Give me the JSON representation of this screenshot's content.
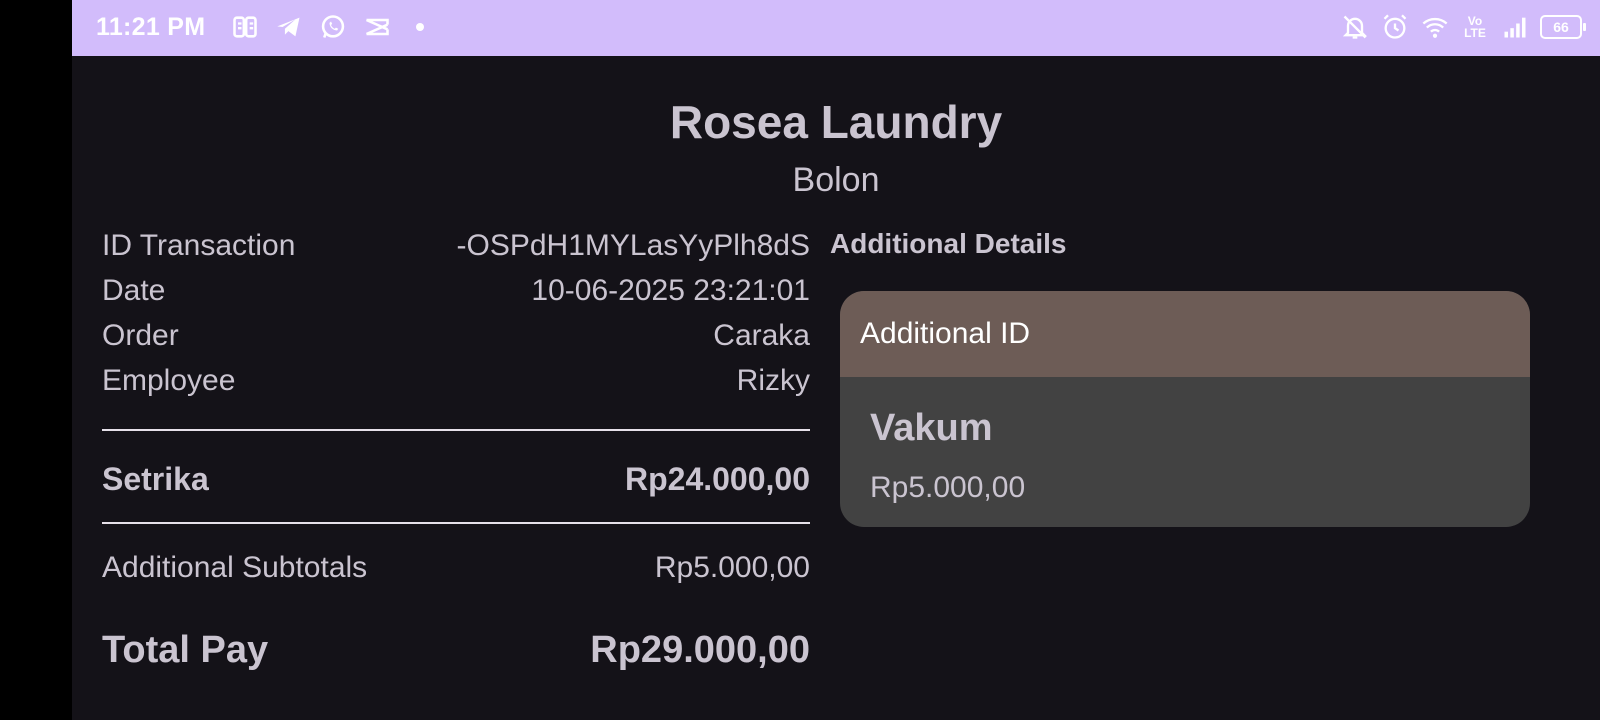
{
  "status_bar": {
    "time": "11:21 PM",
    "left_icons": [
      "parking-app-icon",
      "telegram-icon",
      "whatsapp-icon",
      "capcut-icon"
    ],
    "right_icons": [
      "notifications-off-icon",
      "alarm-icon",
      "wifi-icon",
      "volte-icon",
      "signal-icon",
      "battery-icon"
    ],
    "volte_label_top": "Vo",
    "volte_label_bottom": "LTE",
    "battery_level": "66",
    "background_color": "#d2bcfb"
  },
  "receipt": {
    "shop_name": "Rosea Laundry",
    "branch": "Bolon",
    "info": [
      {
        "label": "ID Transaction",
        "value": "-OSPdH1MYLasYyPlh8dS"
      },
      {
        "label": "Date",
        "value": "10-06-2025 23:21:01"
      },
      {
        "label": "Order",
        "value": "Caraka"
      },
      {
        "label": "Employee",
        "value": "Rizky"
      }
    ],
    "service": {
      "name": "Setrika",
      "price": "Rp24.000,00"
    },
    "additional_subtotal": {
      "label": "Additional Subtotals",
      "value": "Rp5.000,00"
    },
    "total": {
      "label": "Total Pay",
      "value": "Rp29.000,00"
    }
  },
  "additional_details": {
    "title": "Additional Details",
    "card_header": "Additional ID",
    "items": [
      {
        "name": "Vakum",
        "price": "Rp5.000,00"
      }
    ],
    "header_color": "#6d5c56"
  },
  "colors": {
    "background": "#141218",
    "text": "#cac4d0",
    "card_body": "#424242"
  }
}
